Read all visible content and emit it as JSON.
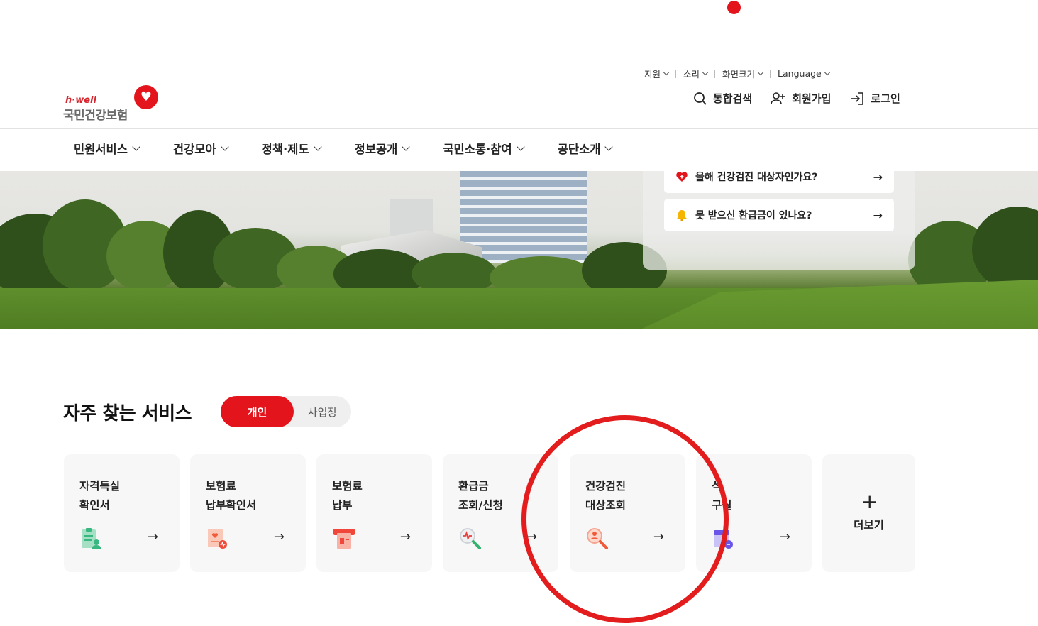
{
  "utility_links": [
    {
      "label": "지원"
    },
    {
      "label": "소리"
    },
    {
      "label": "화면크기"
    },
    {
      "label": "Language"
    }
  ],
  "logo": {
    "brand": "h·well",
    "name": "국민건강보험"
  },
  "actions": {
    "search_label": "통합검색",
    "signup_label": "회원가입",
    "login_label": "로그인"
  },
  "gnb": [
    {
      "label": "민원서비스"
    },
    {
      "label": "건강모아"
    },
    {
      "label": "정책·제도"
    },
    {
      "label": "정보공개"
    },
    {
      "label": "국민소통·참여"
    },
    {
      "label": "공단소개"
    }
  ],
  "hero": {
    "items": [
      {
        "label": "올해 건강검진 대상자인가요?",
        "arrow": "→"
      },
      {
        "label": "못 받으신 환급금이 있나요?",
        "arrow": "→"
      }
    ]
  },
  "services": {
    "title": "자주 찾는 서비스",
    "toggle": {
      "active": "개인",
      "inactive": "사업장"
    },
    "cards": [
      {
        "line1": "자격득실",
        "line2": "확인서",
        "icon": "certificate-icon",
        "arrow": "→"
      },
      {
        "line1": "보험료",
        "line2": "납부확인서",
        "icon": "payment-certificate-icon",
        "arrow": "→"
      },
      {
        "line1": "보험료",
        "line2": "납부",
        "icon": "card-payment-icon",
        "arrow": "→"
      },
      {
        "line1": "환급금",
        "line2": "조회/신청",
        "icon": "refund-search-icon",
        "arrow": "→"
      },
      {
        "line1": "건강검진",
        "line2": "대상조회",
        "icon": "checkup-search-icon",
        "arrow": "→"
      },
      {
        "line1": "식",
        "line2": "구실",
        "icon": "calendar-icon",
        "arrow": "→"
      }
    ],
    "more_plus": "+",
    "more_label": "더보기"
  },
  "colors": {
    "accent": "#e3141b",
    "card_bg": "#f7f7f7",
    "annotation": "#e31d1d"
  }
}
